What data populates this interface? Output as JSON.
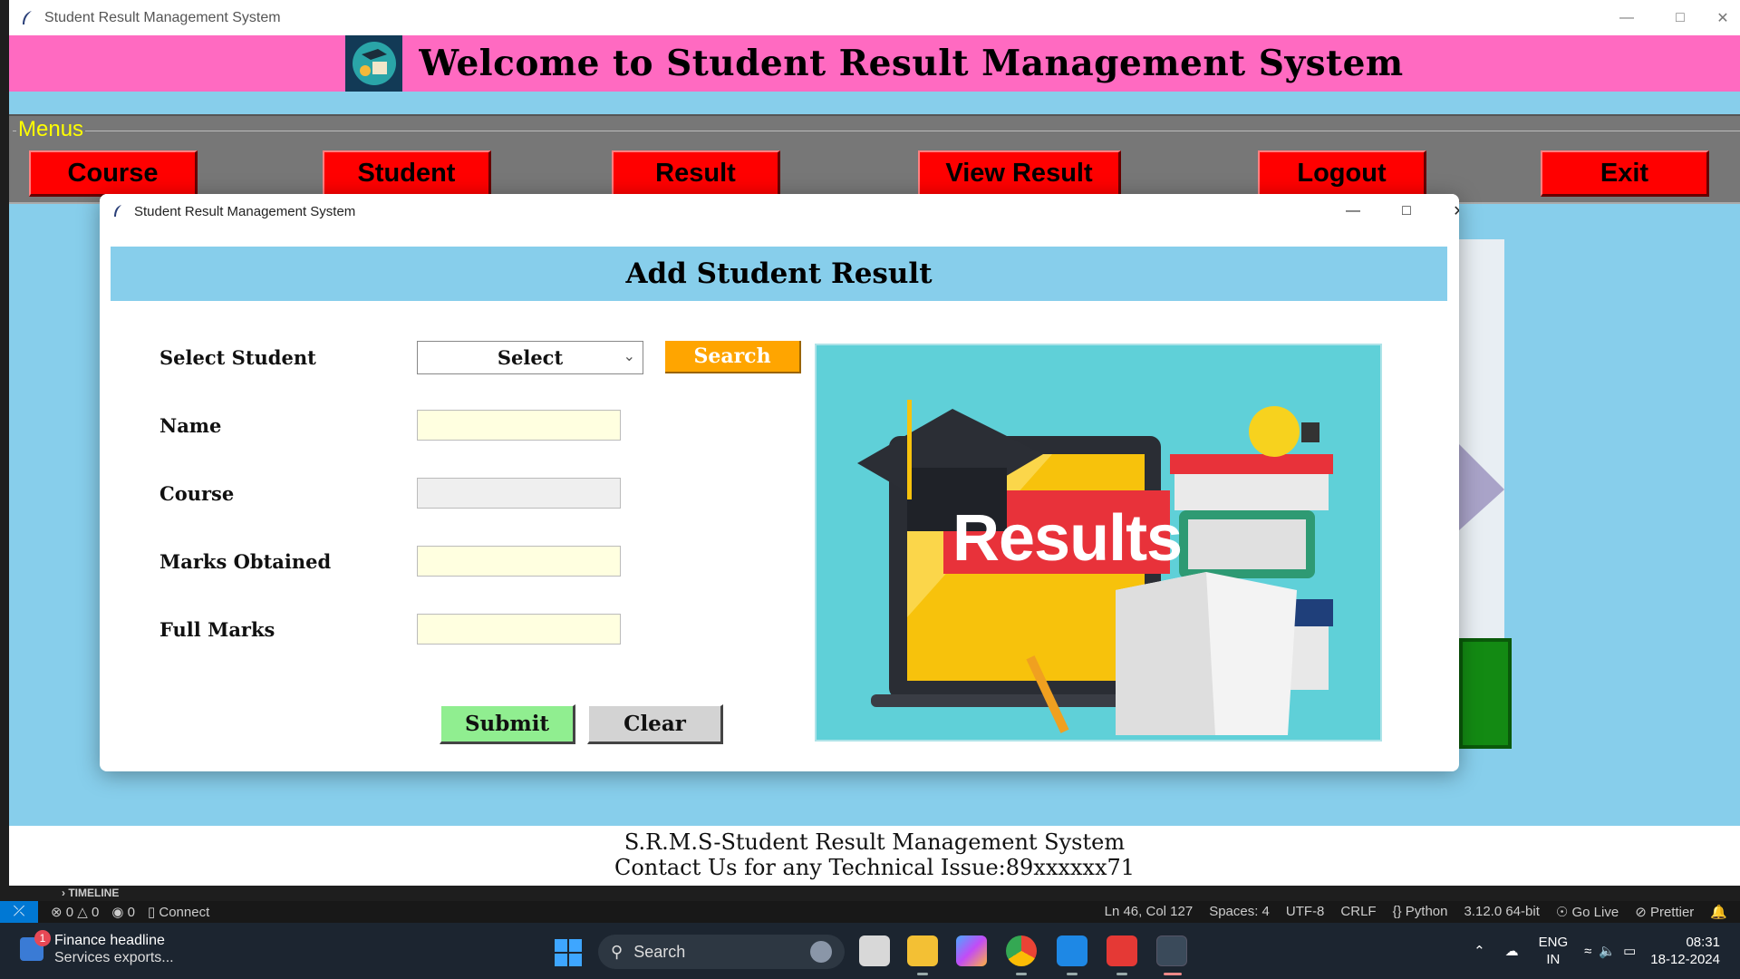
{
  "main_window": {
    "title": "Student Result Management System",
    "banner_title": "Welcome to Student Result Management System"
  },
  "menu": {
    "legend": "Menus",
    "buttons": [
      "Course",
      "Student",
      "Result",
      "View Result",
      "Logout",
      "Exit"
    ]
  },
  "footer": {
    "line1": "S.R.M.S-Student Result Management System",
    "line2": "Contact Us for any Technical Issue:89xxxxxx71"
  },
  "dialog": {
    "title": "Student Result Management System",
    "header": "Add Student Result",
    "labels": {
      "select_student": "Select Student",
      "name": "Name",
      "course": "Course",
      "marks_obtained": "Marks Obtained",
      "full_marks": "Full Marks"
    },
    "select_value": "Select",
    "search_label": "Search",
    "fields": {
      "name": "",
      "course": "",
      "marks_obtained": "",
      "full_marks": ""
    },
    "submit_label": "Submit",
    "clear_label": "Clear",
    "image_text": "Results"
  },
  "vscode": {
    "timeline": "TIMELINE",
    "status_left": {
      "errors": "0",
      "warnings": "0",
      "ports": "0",
      "connect": "Connect"
    },
    "status_right": [
      "Ln 46, Col 127",
      "Spaces: 4",
      "UTF-8",
      "CRLF",
      "{} Python",
      "3.12.0 64-bit",
      "Go Live",
      "Prettier"
    ]
  },
  "taskbar": {
    "news_title": "Finance headline",
    "news_sub": "Services exports...",
    "news_badge": "1",
    "search_placeholder": "Search",
    "lang_top": "ENG",
    "lang_bottom": "IN",
    "time": "08:31",
    "date": "18-12-2024"
  },
  "colors": {
    "banner": "#ff6ac1",
    "sky": "#87ceeb",
    "menu_button": "#ff0000",
    "search_button": "#ffa500",
    "submit_button": "#90ee90",
    "clear_button": "#d3d3d3",
    "input_bg": "#ffffe0"
  }
}
